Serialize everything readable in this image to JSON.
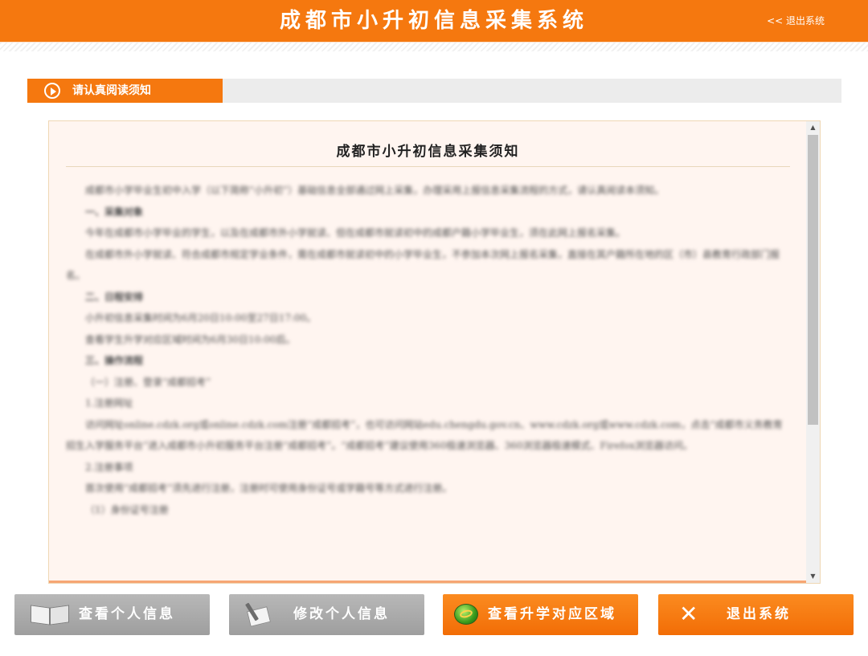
{
  "header": {
    "title": "成都市小升初信息采集系统",
    "logout_link": "<< 退出系统"
  },
  "section": {
    "title": "请认真阅读须知"
  },
  "notice": {
    "title": "成都市小升初信息采集须知",
    "paragraphs": [
      "成都市小学毕业生初中入学（以下简称“小升初”）基础信息全部通过网上采集，办理采用上报信息采集流程的方式，请认真阅读本须知。",
      "一、采集对象",
      "今年在成都市小学毕业的学生，以及在成都市外小学就读、但在成都市就读初中的成都户籍小学毕业生，须在此网上报名采集。",
      "在成都市外小学就读、符合成都市规定学业条件，需在成都市就读初中的小学毕业生，不参加本次网上报名采集，直接在其户籍所在地的区（市）县教育行政部门报名。",
      "二、日程安排",
      "小升初信息采集时间为6月20日10:00至27日17:00。",
      "查看学生升学对应区域时间为6月30日10:00后。",
      "三、操作流程",
      "（一）注册、登录“成都招考”",
      "1.注册网址",
      "访问网址online.cdzk.org或online.cdzk.com注册“成都招考”，也可访问网站edu.chengdu.gov.cn、www.cdzk.org或www.cdzk.com，点击“成都市义务教育招生入学服务平台”进入成都市小升初服务平台注册“成都招考”。“成都招考”建议使用360极速浏览器、360浏览器极速模式、Firefox浏览器访问。",
      "2.注册事项",
      "首次使用“成都招考”须先进行注册，注册时可使用身份证号或学籍号等方式进行注册。",
      "（1）身份证号注册"
    ]
  },
  "scrollbar": {
    "up_arrow": "▲",
    "down_arrow": "▼"
  },
  "buttons": {
    "view_info": "查看个人信息",
    "edit_info": "修改个人信息",
    "view_region": "查看升学对应区域",
    "exit": "退出系统",
    "exit_icon": "✕"
  },
  "colors": {
    "accent": "#f5780f",
    "button_gray": "#aaaaaa",
    "notice_bg": "#fff5f0"
  }
}
